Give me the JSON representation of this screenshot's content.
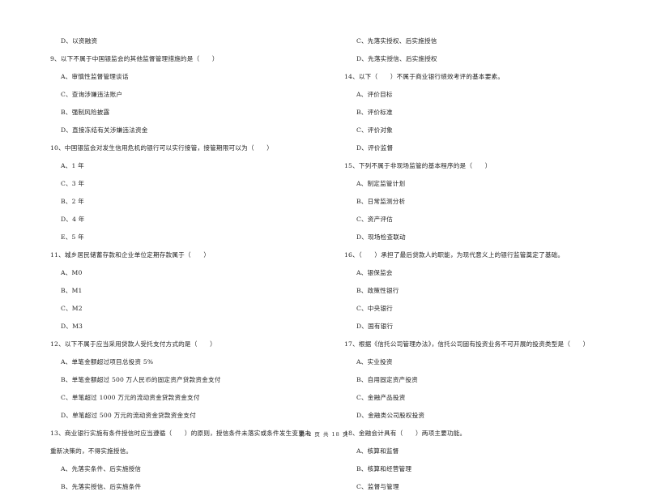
{
  "left_column": [
    {
      "type": "option",
      "text": "D、以资融资"
    },
    {
      "type": "question",
      "text": "9、以下不属于中国银监会的其他监督管理措施的是（　　）"
    },
    {
      "type": "option",
      "text": "A、审慎性监督管理谈话"
    },
    {
      "type": "option",
      "text": "C、查询涉嫌违法账户"
    },
    {
      "type": "option",
      "text": "B、强制风险披露"
    },
    {
      "type": "option",
      "text": "D、直接冻结有关涉嫌违法资金"
    },
    {
      "type": "question",
      "text": "10、中国银监会对发生信用危机的银行可以实行接管，接管期限可以为（　　）"
    },
    {
      "type": "option",
      "text": "A、1 年"
    },
    {
      "type": "option",
      "text": "C、3 年"
    },
    {
      "type": "option",
      "text": "B、2 年"
    },
    {
      "type": "option",
      "text": "D、4 年"
    },
    {
      "type": "option",
      "text": "E、5 年"
    },
    {
      "type": "question",
      "text": "11、城乡居民储蓄存款和企业单位定期存款属于（　　）"
    },
    {
      "type": "option",
      "text": "A、M0"
    },
    {
      "type": "option",
      "text": "B、M1"
    },
    {
      "type": "option",
      "text": "C、M2"
    },
    {
      "type": "option",
      "text": "D、M3"
    },
    {
      "type": "question",
      "text": "12、以下不属于应当采用贷款人受托支付方式的是（　　）"
    },
    {
      "type": "option",
      "text": "A、单笔金额超过项目总投资 5%"
    },
    {
      "type": "option",
      "text": "B、单笔金额超过 500 万人民币的固定资产贷款资金支付"
    },
    {
      "type": "option",
      "text": "C、单笔超过 1000 万元的流动资金贷款资金支付"
    },
    {
      "type": "option",
      "text": "D、单笔超过 500 万元的流动资金贷款资金支付"
    },
    {
      "type": "question",
      "text": "13、商业银行实施有条件授信时应当遵循（　　）的原则，授信条件未落实或条件发生变更未"
    },
    {
      "type": "question",
      "text": "重新决策的，不得实施授信。"
    },
    {
      "type": "option",
      "text": "A、先落实条件、后实施授信"
    },
    {
      "type": "option",
      "text": "B、先落实授信、后实施条件"
    }
  ],
  "right_column": [
    {
      "type": "option",
      "text": "C、先落实授权、后实施授信"
    },
    {
      "type": "option",
      "text": "D、先落实授信、后实施授权"
    },
    {
      "type": "question",
      "text": "14、以下（　　）不属于商业银行绩效考评的基本要素。"
    },
    {
      "type": "option",
      "text": "A、评价目标"
    },
    {
      "type": "option",
      "text": "B、评价标准"
    },
    {
      "type": "option",
      "text": "C、评价对象"
    },
    {
      "type": "option",
      "text": "D、评价监督"
    },
    {
      "type": "question",
      "text": "15、下列不属于非现场监管的基本程序的是（　　）"
    },
    {
      "type": "option",
      "text": "A、制定监管计划"
    },
    {
      "type": "option",
      "text": "B、日常监测分析"
    },
    {
      "type": "option",
      "text": "C、资产评估"
    },
    {
      "type": "option",
      "text": "D、现场检查联动"
    },
    {
      "type": "question",
      "text": "16、（　　）承担了最后贷款人的职能，为现代意义上的银行监管奠定了基础。"
    },
    {
      "type": "option",
      "text": "A、银保监会"
    },
    {
      "type": "option",
      "text": "B、政策性银行"
    },
    {
      "type": "option",
      "text": "C、中央银行"
    },
    {
      "type": "option",
      "text": "D、国有银行"
    },
    {
      "type": "question",
      "text": "17、根据《信托公司管理办法》，信托公司固有投资业务不可开展的投资类型是（　　）"
    },
    {
      "type": "option",
      "text": "A、实业投资"
    },
    {
      "type": "option",
      "text": "B、自用固定资产投资"
    },
    {
      "type": "option",
      "text": "C、金融产品投资"
    },
    {
      "type": "option",
      "text": "D、金融类公司股权投资"
    },
    {
      "type": "question",
      "text": "18、金融会计具有（　　）两项主要功能。"
    },
    {
      "type": "option",
      "text": "A、核算和监督"
    },
    {
      "type": "option",
      "text": "B、核算和经营管理"
    },
    {
      "type": "option",
      "text": "C、监督与管理"
    }
  ],
  "footer": {
    "page_label": "第 2 页 共 18 页"
  }
}
